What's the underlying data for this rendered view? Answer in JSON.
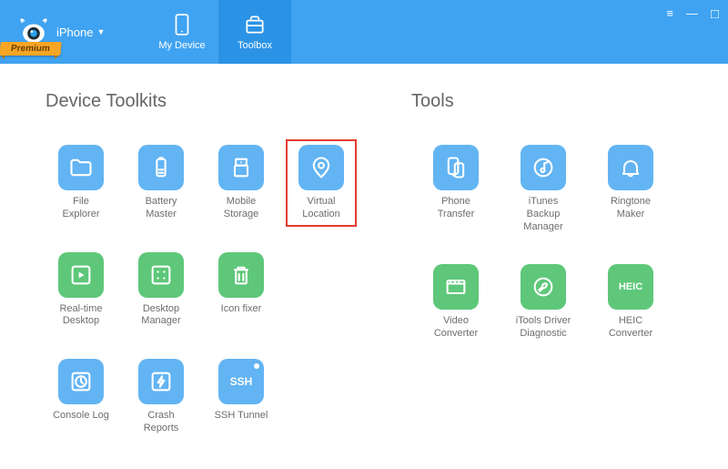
{
  "brand": {
    "device_label": "iPhone",
    "badge": "Premium"
  },
  "nav": {
    "my_device": "My Device",
    "toolbox": "Toolbox"
  },
  "sections": {
    "device_toolkits_title": "Device Toolkits",
    "tools_title": "Tools"
  },
  "device_toolkits": [
    {
      "id": "file-explorer",
      "label": "File\nExplorer",
      "color": "blue",
      "icon": "folder"
    },
    {
      "id": "battery-master",
      "label": "Battery Master",
      "color": "blue",
      "icon": "battery"
    },
    {
      "id": "mobile-storage",
      "label": "Mobile Storage",
      "color": "blue",
      "icon": "usb"
    },
    {
      "id": "virtual-location",
      "label": "Virtual Location",
      "color": "blue",
      "icon": "pin",
      "highlight": true
    },
    {
      "id": "realtime-desktop",
      "label": "Real-time\nDesktop",
      "color": "green",
      "icon": "play"
    },
    {
      "id": "desktop-manager",
      "label": "Desktop\nManager",
      "color": "green",
      "icon": "grid"
    },
    {
      "id": "icon-fixer",
      "label": "Icon fixer",
      "color": "green",
      "icon": "trash"
    },
    {
      "id": "console-log",
      "label": "Console Log",
      "color": "blue",
      "icon": "clock"
    },
    {
      "id": "crash-reports",
      "label": "Crash Reports",
      "color": "blue",
      "icon": "bolt"
    },
    {
      "id": "ssh-tunnel",
      "label": "SSH Tunnel",
      "color": "blue",
      "icon": "ssh",
      "dot": true
    }
  ],
  "tools": [
    {
      "id": "phone-transfer",
      "label": "Phone Transfer",
      "color": "blue",
      "icon": "transfer"
    },
    {
      "id": "itunes-backup",
      "label": "iTunes Backup\nManager",
      "color": "blue",
      "icon": "itunes"
    },
    {
      "id": "ringtone-maker",
      "label": "Ringtone Maker",
      "color": "blue",
      "icon": "bell"
    },
    {
      "id": "video-converter",
      "label": "Video\nConverter",
      "color": "green",
      "icon": "video"
    },
    {
      "id": "itools-driver",
      "label": "iTools Driver\nDiagnostic",
      "color": "green",
      "icon": "wrench"
    },
    {
      "id": "heic-converter",
      "label": "HEIC Converter",
      "color": "green",
      "icon": "heic"
    }
  ],
  "colors": {
    "primary": "#40a3f1",
    "primary_dark": "#2b93e6",
    "tile_blue": "#62b4f3",
    "tile_green": "#5ec77a",
    "highlight_border": "#e23b2e",
    "ribbon": "#f5a623"
  }
}
